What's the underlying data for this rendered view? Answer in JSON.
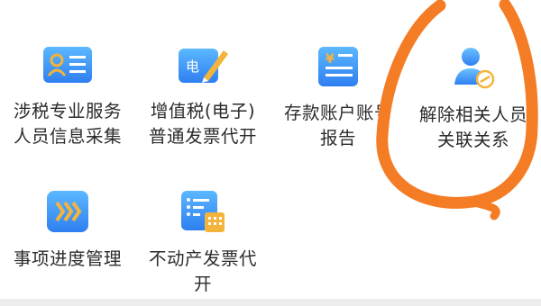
{
  "services": [
    {
      "id": "tax-staff-info",
      "label": "涉税专业服务\n人员信息采集",
      "icon": "id-card-icon"
    },
    {
      "id": "vat-e-invoice",
      "label": "增值税(电子)\n普通发票代开",
      "icon": "e-invoice-pen-icon",
      "badge": "电"
    },
    {
      "id": "deposit-account-report",
      "label": "存款账户账号\n报告",
      "icon": "yuan-document-icon",
      "badge": "¥"
    },
    {
      "id": "unlink-related-person",
      "label": "解除相关人员\n关联关系",
      "icon": "person-unlink-icon"
    },
    {
      "id": "progress-management",
      "label": "事项进度管理",
      "icon": "double-chevron-right-icon"
    },
    {
      "id": "real-estate-invoice",
      "label": "不动产发票代\n开",
      "icon": "building-list-icon"
    }
  ],
  "colors": {
    "icon_gradient_top": "#5bb8ff",
    "icon_gradient_bottom": "#2f7ff0",
    "accent_orange": "#f4b43b",
    "annotation_orange": "#f47c25"
  }
}
